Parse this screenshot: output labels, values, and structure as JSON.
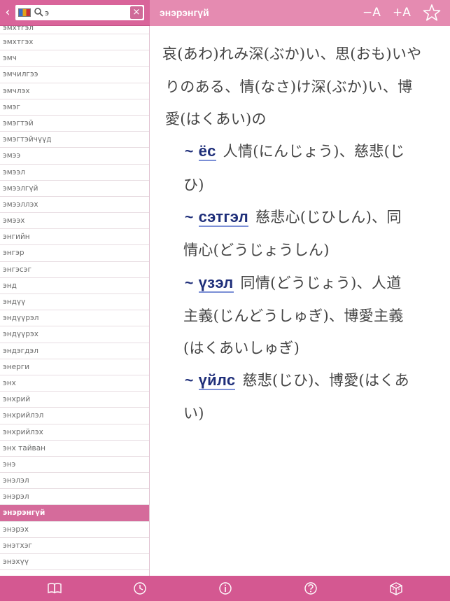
{
  "search": {
    "value": "э",
    "clear_icon": "×",
    "back_icon": "‹"
  },
  "header": {
    "headword": "энэрэнгүй",
    "font_smaller": "−A",
    "font_larger": "+A",
    "star_icon": "☆"
  },
  "word_list": [
    "эмхтгэл",
    "эмхтгэх",
    "эмч",
    "эмчилгээ",
    "эмчлэх",
    "эмэг",
    "эмэгтэй",
    "эмэгтэйчүүд",
    "эмээ",
    "эмээл",
    "эмээлгүй",
    "эмээллэх",
    "эмээх",
    "энгийн",
    "энгэр",
    "энгэсэг",
    "энд",
    "эндүү",
    "эндүүрэл",
    "эндүүрэх",
    "эндэгдэл",
    "энерги",
    "энх",
    "энхрий",
    "энхрийлэл",
    "энхрийлэх",
    "энх тайван",
    "энэ",
    "энэлэл",
    "энэрэл",
    "энэрэнгүй",
    "энэрэх",
    "энэтхэг",
    "энэхүү"
  ],
  "selected_index": 30,
  "entry": {
    "definition_lines": [
      "哀(あわ)れみ深(ぶか)い、思(おも)いや",
      "りのある、情(なさ)け深(ぶか)い、博",
      "愛(はくあい)の"
    ],
    "tilde": "~",
    "phrases": [
      {
        "phrase": "ёс",
        "line1": "人情(にんじょう)、慈悲(じ",
        "line2": "ひ)"
      },
      {
        "phrase": "сэтгэл",
        "line1": "慈悲心(じひしん)、同",
        "line2": "情心(どうじょうしん)"
      },
      {
        "phrase": "үзэл",
        "line1": "同情(どうじょう)、人道",
        "line2": "主義(じんどうしゅぎ)、博愛主義",
        "line3": "(はくあいしゅぎ)"
      },
      {
        "phrase": "үйлс",
        "line1": "慈悲(じひ)、博愛(はくあ",
        "line2": "い)"
      }
    ]
  },
  "toolbar": {
    "items": [
      "book-icon",
      "history-icon",
      "info-icon",
      "help-icon",
      "cube-icon"
    ]
  },
  "colors": {
    "header_dark": "#d9649a",
    "header_light": "#e58bb1",
    "toolbar": "#d45891",
    "selected_row": "#d56b9b",
    "phrase_text": "#1f2f7a"
  }
}
